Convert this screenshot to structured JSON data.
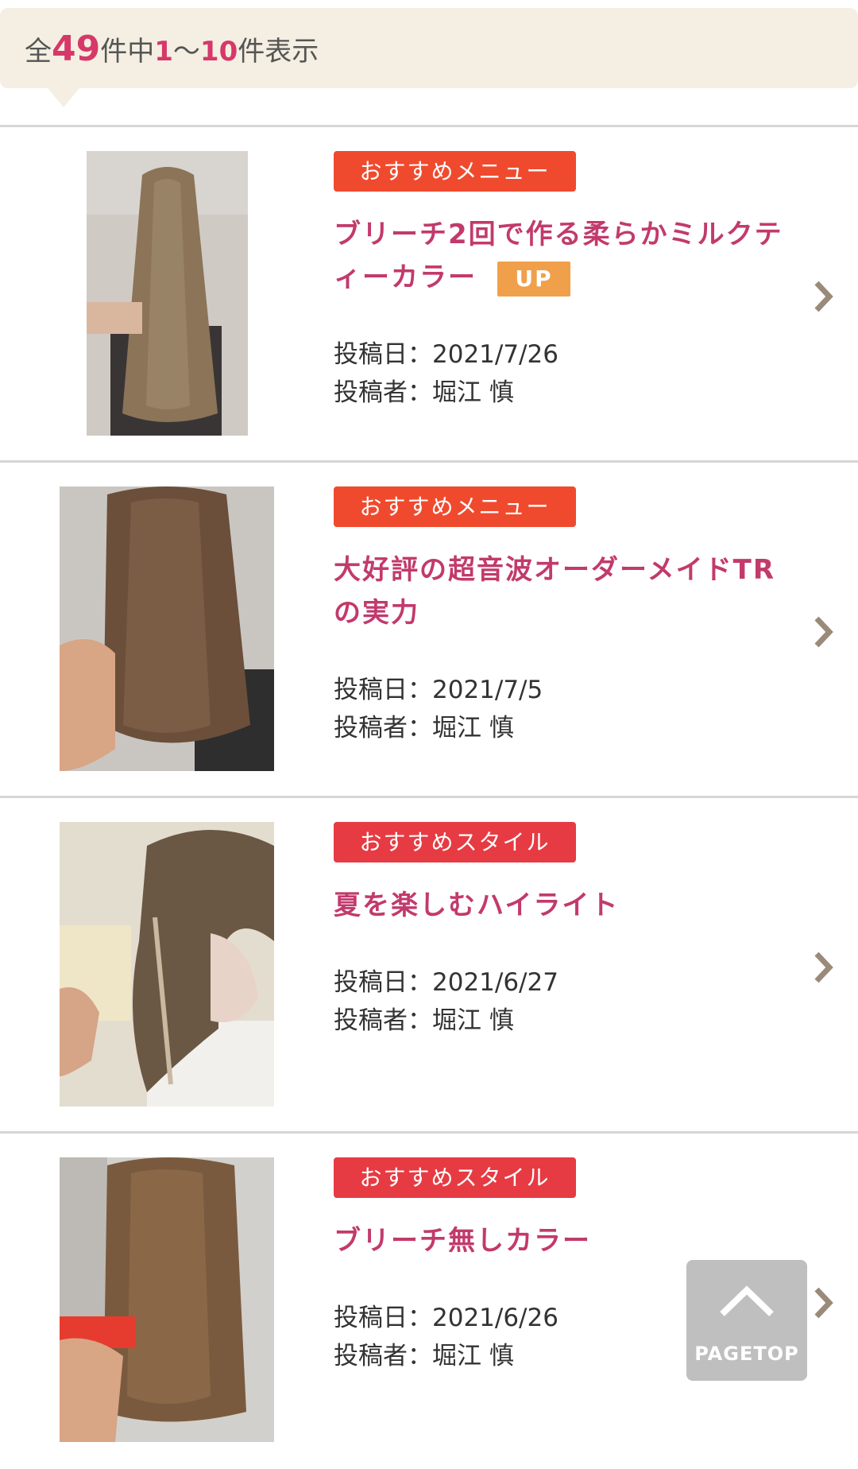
{
  "result_count": {
    "prefix": "全",
    "total": "49",
    "mid": "件中",
    "from": "1",
    "sep": "～",
    "to": "10",
    "suffix": "件表示"
  },
  "items": [
    {
      "badge": "おすすめメニュー",
      "title": "ブリーチ2回で作る柔らかミルクティーカラー",
      "up_label": "UP",
      "date": "投稿日：2021/7/26",
      "author": "投稿者：堀江 慎"
    },
    {
      "badge": "おすすめメニュー",
      "title": "大好評の超音波オーダーメイドTRの実力",
      "date": "投稿日：2021/7/5",
      "author": "投稿者：堀江 慎"
    },
    {
      "badge": "おすすめスタイル",
      "title": "夏を楽しむハイライト",
      "date": "投稿日：2021/6/27",
      "author": "投稿者：堀江 慎"
    },
    {
      "badge": "おすすめスタイル",
      "title": "ブリーチ無しカラー",
      "date": "投稿日：2021/6/26",
      "author": "投稿者：堀江 慎"
    }
  ],
  "pagetop_label": "PAGETOP",
  "colors": {
    "accent_pink": "#c23a6b",
    "count_pink": "#d6386a",
    "menu_badge": "#f04a2e",
    "style_badge": "#e63b43",
    "up_badge": "#f0a04a",
    "count_bar_bg": "#f4efe2"
  }
}
